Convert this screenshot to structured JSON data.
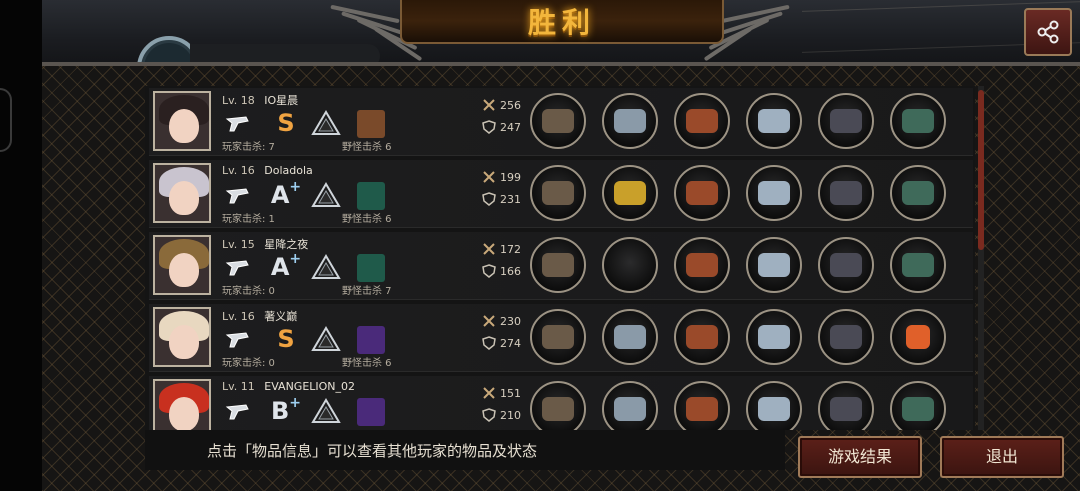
{
  "header": {
    "title": "胜利",
    "share_icon": "share-icon"
  },
  "players": [
    {
      "level": "Lv. 18",
      "name": "IO星晨",
      "weapon_icon": "pistol-icon",
      "grade": "S",
      "grade_plus": "",
      "tier_icon": "triangle-icon",
      "player_kills": "玩家击杀: 7",
      "monster_kills": "野怪击杀 6",
      "attack": "256",
      "defense": "247",
      "items": [
        "sniper-rifle-icon",
        "helmet-icon",
        "armor-icon",
        "arm-blade-icon",
        "boots-icon",
        "goggles-icon"
      ],
      "hair": "#2a2020",
      "monster_color": "#7a4a2a"
    },
    {
      "level": "Lv. 16",
      "name": "Doladola",
      "weapon_icon": "knife-icon",
      "grade": "A",
      "grade_plus": "+",
      "tier_icon": "triangle-icon",
      "player_kills": "玩家击杀: 1",
      "monster_kills": "野怪击杀 6",
      "attack": "199",
      "defense": "231",
      "items": [
        "scythe-icon",
        "crown-icon",
        "armor-icon",
        "arm-blade-icon",
        "boots-icon",
        "bracer-icon"
      ],
      "hair": "#c9c4cf",
      "monster_color": "#1f5a4a"
    },
    {
      "level": "Lv. 15",
      "name": "星降之夜",
      "weapon_icon": "rapier-icon",
      "grade": "A",
      "grade_plus": "+",
      "tier_icon": "diamond-icon",
      "player_kills": "玩家击杀: 0",
      "monster_kills": "野怪击杀 7",
      "attack": "172",
      "defense": "166",
      "items": [
        "claw-icon",
        "empty-slot-icon",
        "armor-icon",
        "disc-icon",
        "boots-icon",
        "bracer-icon"
      ],
      "hair": "#8a6a3a",
      "monster_color": "#1f5a4a"
    },
    {
      "level": "Lv. 16",
      "name": "著义巅",
      "weapon_icon": "shuriken-icon",
      "grade": "S",
      "grade_plus": "",
      "tier_icon": "diamond-icon",
      "player_kills": "玩家击杀: 0",
      "monster_kills": "野怪击杀 6",
      "attack": "230",
      "defense": "274",
      "items": [
        "blade-icon",
        "helmet-icon",
        "armor-icon",
        "bracelet-icon",
        "boots-icon",
        "dice-icon"
      ],
      "hair": "#e8d8c0",
      "monster_color": "#4a2a7a"
    },
    {
      "level": "Lv. 11",
      "name": "EVANGELION_02",
      "weapon_icon": "shuriken-icon",
      "grade": "B",
      "grade_plus": "+",
      "tier_icon": "hexagon-icon",
      "player_kills": "",
      "monster_kills": "",
      "attack": "151",
      "defense": "210",
      "items": [
        "blade-icon",
        "helmet-icon",
        "armor-icon",
        "arrowhead-icon",
        "heels-icon",
        "bracer-icon"
      ],
      "hair": "#c8301f",
      "monster_color": "#4a2a7a"
    }
  ],
  "footer": {
    "hint": "点击「物品信息」可以查看其他玩家的物品及状态"
  },
  "buttons": {
    "result": "游戏结果",
    "exit": "退出"
  },
  "colors": {
    "victory": "#f3b63c",
    "button_bg": "#5c2019",
    "button_border": "#a07a58"
  }
}
